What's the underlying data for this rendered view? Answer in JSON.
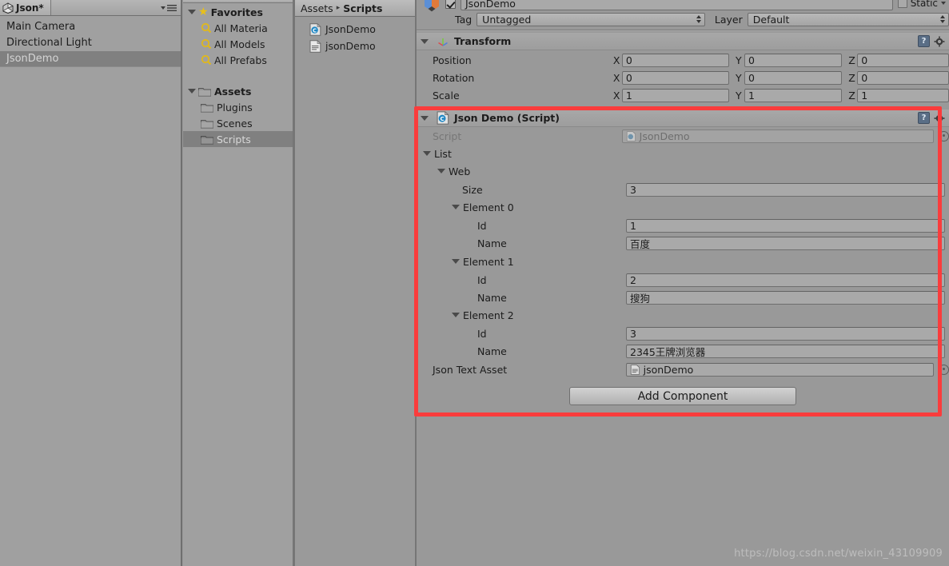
{
  "app": "Unity Editor",
  "hierarchy": {
    "tab_label": "Json*",
    "logo_icon": "unity-logo-icon",
    "menu_icon": "panel-menu-icon",
    "items": [
      {
        "label": "Main Camera",
        "selected": false
      },
      {
        "label": "Directional Light",
        "selected": false
      },
      {
        "label": "JsonDemo",
        "selected": true
      }
    ]
  },
  "project": {
    "tree": [
      {
        "label": "Favorites",
        "icon": "star-icon",
        "depth": 0,
        "bold": true,
        "expanded": true,
        "selected": false
      },
      {
        "label": "All Materia",
        "icon": "search-icon",
        "depth": 1,
        "bold": false,
        "expanded": false,
        "selected": false
      },
      {
        "label": "All Models",
        "icon": "search-icon",
        "depth": 1,
        "bold": false,
        "expanded": false,
        "selected": false
      },
      {
        "label": "All Prefabs",
        "icon": "search-icon",
        "depth": 1,
        "bold": false,
        "expanded": false,
        "selected": false
      },
      {
        "label": "Assets",
        "icon": "folder-icon",
        "depth": 0,
        "bold": true,
        "expanded": true,
        "selected": false
      },
      {
        "label": "Plugins",
        "icon": "folder-icon",
        "depth": 1,
        "bold": false,
        "expanded": false,
        "selected": false
      },
      {
        "label": "Scenes",
        "icon": "folder-icon",
        "depth": 1,
        "bold": false,
        "expanded": false,
        "selected": false
      },
      {
        "label": "Scripts",
        "icon": "folder-icon",
        "depth": 1,
        "bold": false,
        "expanded": false,
        "selected": true
      }
    ],
    "breadcrumb": {
      "root": "Assets",
      "separator": "▸",
      "current": "Scripts"
    },
    "assets": [
      {
        "label": "JsonDemo",
        "icon": "csharp-script-icon"
      },
      {
        "label": "jsonDemo",
        "icon": "text-asset-icon"
      }
    ]
  },
  "inspector": {
    "gameobject": {
      "icon": "gameobject-cube-icon",
      "enabled": true,
      "name": "JsonDemo",
      "static_label": "Static",
      "static_checked": false,
      "tag_label": "Tag",
      "tag_value": "Untagged",
      "layer_label": "Layer",
      "layer_value": "Default"
    },
    "transform": {
      "title": "Transform",
      "icon": "transform-axis-icon",
      "help_icon": "help-icon",
      "gear_icon": "gear-icon",
      "rows": [
        {
          "label": "Position",
          "x": "0",
          "y": "0",
          "z": "0"
        },
        {
          "label": "Rotation",
          "x": "0",
          "y": "0",
          "z": "0"
        },
        {
          "label": "Scale",
          "x": "1",
          "y": "1",
          "z": "1"
        }
      ],
      "axis_x": "X",
      "axis_y": "Y",
      "axis_z": "Z"
    },
    "json_demo": {
      "title": "Json Demo (Script)",
      "icon": "csharp-script-icon",
      "help_icon": "help-icon",
      "gear_icon": "gear-icon",
      "script_label": "Script",
      "script_value": "JsonDemo",
      "list_label": "List",
      "web_label": "Web",
      "size_label": "Size",
      "size_value": "3",
      "elements": [
        {
          "label": "Element 0",
          "id_label": "Id",
          "id_value": "1",
          "name_label": "Name",
          "name_value": "百度"
        },
        {
          "label": "Element 1",
          "id_label": "Id",
          "id_value": "2",
          "name_label": "Name",
          "name_value": "搜狗"
        },
        {
          "label": "Element 2",
          "id_label": "Id",
          "id_value": "3",
          "name_label": "Name",
          "name_value": "2345王牌浏览器"
        }
      ],
      "json_text_asset_label": "Json Text Asset",
      "json_text_asset_value": "jsonDemo"
    },
    "add_component_label": "Add Component"
  },
  "watermark": "https://blog.csdn.net/weixin_43109909",
  "colors": {
    "panel_bg": "#9a9a9a",
    "selection": "#808080",
    "annotation_red": "#fa3c3c",
    "field_bg": "#a9a9a9"
  }
}
